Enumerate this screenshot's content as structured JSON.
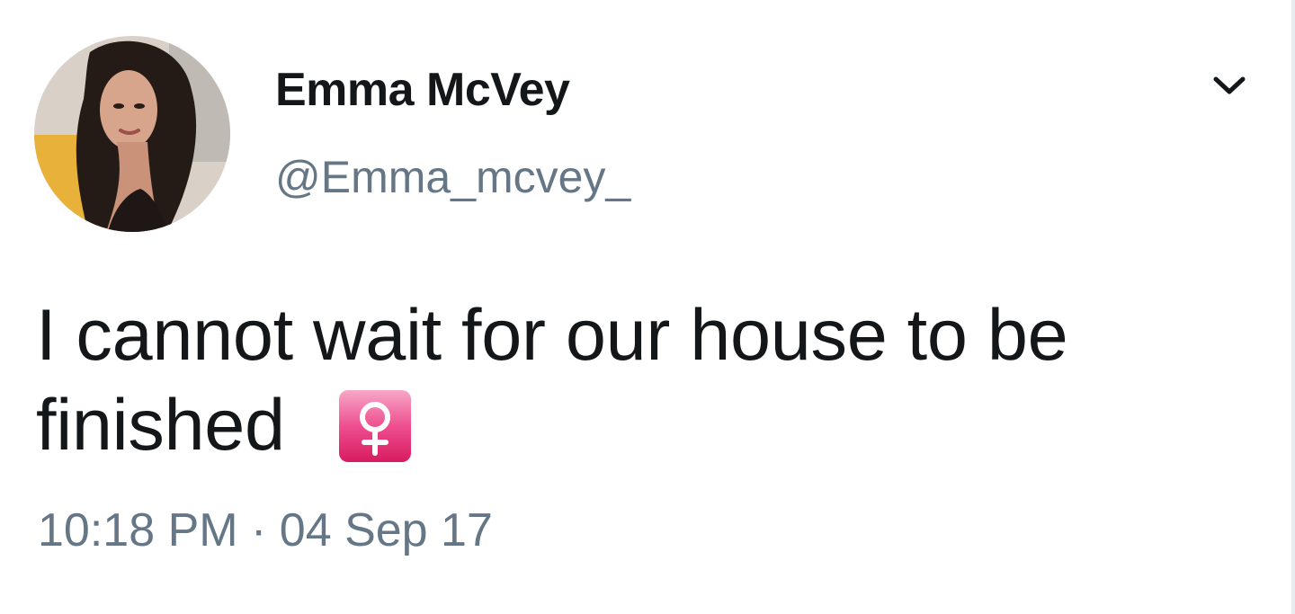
{
  "tweet": {
    "display_name": "Emma McVey",
    "handle": "@Emma_mcvey_",
    "text_line_1": "I cannot wait for our house to be",
    "text_line_2": "finished",
    "emoji_name": "female-sign-emoji",
    "timestamp": "10:18 PM · 04 Sep 17"
  },
  "icons": {
    "menu": "chevron-down-icon"
  },
  "colors": {
    "text_primary": "#14171a",
    "text_secondary": "#657786",
    "emoji_pink": "#ee4f8f"
  }
}
